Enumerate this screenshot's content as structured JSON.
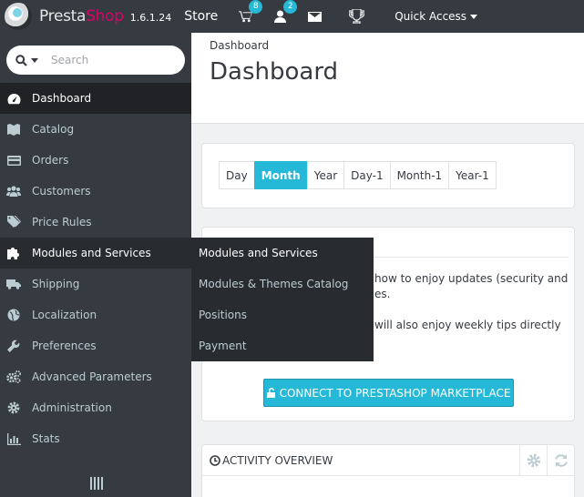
{
  "header": {
    "brand_part1": "Presta",
    "brand_part2": "Shop",
    "version": "1.6.1.24",
    "store_label": "Store",
    "cart_count": "8",
    "customers_count": "2",
    "quick_access_label": "Quick Access"
  },
  "sidebar": {
    "search_placeholder": "Search",
    "items": [
      {
        "label": "Dashboard",
        "icon": "tachometer-icon"
      },
      {
        "label": "Catalog",
        "icon": "book-icon"
      },
      {
        "label": "Orders",
        "icon": "credit-card-icon"
      },
      {
        "label": "Customers",
        "icon": "users-icon"
      },
      {
        "label": "Price Rules",
        "icon": "tags-icon"
      },
      {
        "label": "Modules and Services",
        "icon": "puzzle-icon"
      },
      {
        "label": "Shipping",
        "icon": "truck-icon"
      },
      {
        "label": "Localization",
        "icon": "globe-icon"
      },
      {
        "label": "Preferences",
        "icon": "wrench-icon"
      },
      {
        "label": "Advanced Parameters",
        "icon": "cogs-icon"
      },
      {
        "label": "Administration",
        "icon": "cog-icon"
      },
      {
        "label": "Stats",
        "icon": "bar-chart-icon"
      }
    ]
  },
  "flyout": {
    "items": [
      "Modules and Services",
      "Modules & Themes Catalog",
      "Positions",
      "Payment"
    ]
  },
  "page": {
    "breadcrumb": "Dashboard",
    "title": "Dashboard"
  },
  "period": {
    "buttons": [
      "Day",
      "Month",
      "Year",
      "Day-1",
      "Month-1",
      "Year-1"
    ],
    "active": "Month"
  },
  "marketplace": {
    "line1": "how to enjoy updates (security and",
    "line2": "es.",
    "line3": "will also enjoy weekly tips directly",
    "button_label": "CONNECT TO PRESTASHOP MARKETPLACE"
  },
  "activity": {
    "title": "ACTIVITY OVERVIEW"
  },
  "colors": {
    "accent": "#25b9d7",
    "sidebar_bg": "#363a41",
    "brand_pink": "#df0067"
  }
}
